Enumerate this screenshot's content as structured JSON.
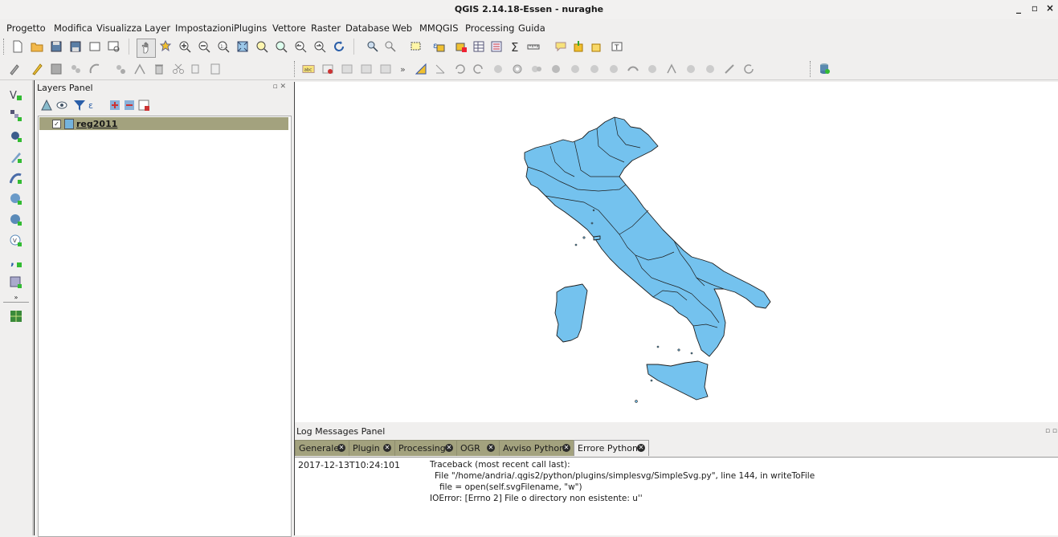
{
  "window": {
    "title": "QGIS 2.14.18-Essen - nuraghe",
    "controls": [
      "_",
      "▫",
      "×"
    ]
  },
  "menu": [
    "Progetto",
    "Modifica",
    "Visualizza",
    "Layer",
    "Impostazioni",
    "Plugins",
    "Vettore",
    "Raster",
    "Database",
    "Web",
    "MMQGIS",
    "Processing",
    "Guida"
  ],
  "toolbar_icons_row1": [
    "new-project-icon",
    "open-project-icon",
    "save-project-icon",
    "save-as-icon",
    "new-print-composer-icon",
    "composer-manager-icon",
    "pan-icon",
    "pan-to-selection-icon",
    "zoom-in-icon",
    "zoom-out-icon",
    "zoom-native-icon",
    "zoom-full-icon",
    "zoom-to-selection-icon",
    "zoom-to-layer-icon",
    "zoom-last-icon",
    "zoom-next-icon",
    "refresh-icon",
    "identify-icon",
    "action-icon",
    "select-features-icon",
    "select-by-expression-icon",
    "deselect-icon",
    "attribute-table-icon",
    "field-calculator-icon",
    "statistics-icon",
    "measure-icon",
    "map-tips-icon",
    "new-bookmark-icon",
    "show-bookmarks-icon",
    "text-annotation-icon"
  ],
  "toolbar_icons_row2": [
    "current-edits-icon",
    "toggle-editing-icon",
    "save-edits-icon",
    "add-feature-icon",
    "add-circular-string-icon",
    "move-feature-icon",
    "node-tool-icon",
    "delete-selected-icon",
    "cut-features-icon",
    "copy-features-icon",
    "paste-features-icon",
    "label-toolbar-icon",
    "pin-labels-icon",
    "highlight-pinned-icon",
    "show-hide-labels-icon",
    "move-label-icon",
    "rotate-label-icon",
    "change-label-icon",
    "digitize-angle-icon",
    "undo-icon",
    "redo-icon",
    "simplify-icon",
    "add-ring-icon",
    "add-part-icon",
    "fill-ring-icon",
    "delete-ring-icon",
    "delete-part-icon",
    "reshape-icon",
    "offset-curve-icon",
    "split-features-icon",
    "split-parts-icon",
    "merge-selected-icon",
    "merge-attributes-icon",
    "rotate-point-icon",
    "db-manager-icon"
  ],
  "left_toolbar": [
    "add-vector-layer-icon",
    "add-raster-layer-icon",
    "add-postgis-layer-icon",
    "add-spatialite-layer-icon",
    "add-mssql-layer-icon",
    "add-wms-layer-icon",
    "add-wcs-layer-icon",
    "add-wfs-layer-icon",
    "add-delimited-text-icon",
    "add-virtual-layer-icon",
    "more-tools-icon",
    "georeferencer-icon"
  ],
  "layers_panel": {
    "title": "Layers Panel",
    "toolbar": [
      "open-layer-styling-icon",
      "add-group-icon",
      "manage-visibility-icon",
      "filter-legend-icon",
      "filter-by-expression-icon",
      "expand-all-icon",
      "collapse-all-icon",
      "remove-layer-icon"
    ],
    "layers": [
      {
        "name": "reg2011",
        "checked": true,
        "color": "#74b3de"
      }
    ]
  },
  "log_panel": {
    "title": "Log Messages Panel",
    "tabs": [
      {
        "label": "Generale",
        "active": false
      },
      {
        "label": "Plugin",
        "active": false
      },
      {
        "label": "Processing",
        "active": false
      },
      {
        "label": "OGR",
        "active": false
      },
      {
        "label": "Avviso Python",
        "active": false
      },
      {
        "label": "Errore Python",
        "active": true
      }
    ],
    "timestamp": "2017-12-13T10:24:101",
    "lines": [
      "Traceback (most recent call last):",
      "File \"/home/andria/.qgis2/python/plugins/simplesvg/SimpleSvg.py\", line 144, in writeToFile",
      "file = open(self.svgFilename, \"w\")",
      "IOError: [Errno 2] File o directory non esistente: u''"
    ]
  },
  "map": {
    "fill": "#74c2ee",
    "stroke": "#1e1e1e",
    "subject": "Italy regions"
  }
}
